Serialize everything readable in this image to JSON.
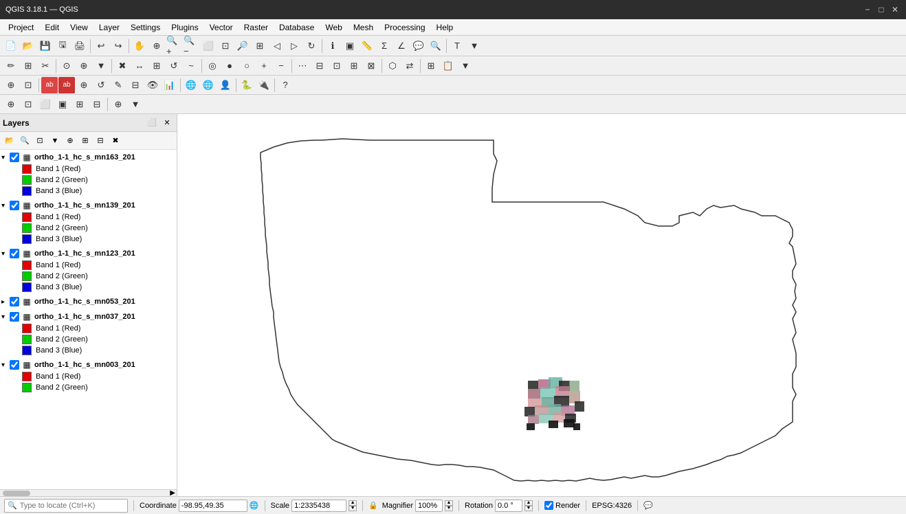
{
  "titlebar": {
    "title": "QGIS 3.18.1 — QGIS",
    "min_btn": "−",
    "max_btn": "□",
    "close_btn": "✕"
  },
  "menubar": {
    "items": [
      {
        "id": "project",
        "label": "Project"
      },
      {
        "id": "edit",
        "label": "Edit"
      },
      {
        "id": "view",
        "label": "View"
      },
      {
        "id": "layer",
        "label": "Layer"
      },
      {
        "id": "settings",
        "label": "Settings"
      },
      {
        "id": "plugins",
        "label": "Plugins"
      },
      {
        "id": "vector",
        "label": "Vector"
      },
      {
        "id": "raster",
        "label": "Raster"
      },
      {
        "id": "database",
        "label": "Database"
      },
      {
        "id": "web",
        "label": "Web"
      },
      {
        "id": "mesh",
        "label": "Mesh"
      },
      {
        "id": "processing",
        "label": "Processing"
      },
      {
        "id": "help",
        "label": "Help"
      }
    ]
  },
  "layers_panel": {
    "title": "Layers",
    "layers": [
      {
        "id": "layer1",
        "name": "ortho_1-1_hc_s_mn163_201",
        "checked": true,
        "expanded": true,
        "bands": [
          {
            "color": "#e00000",
            "label": "Band 1 (Red)"
          },
          {
            "color": "#00cc00",
            "label": "Band 2 (Green)"
          },
          {
            "color": "#0000dd",
            "label": "Band 3 (Blue)"
          }
        ]
      },
      {
        "id": "layer2",
        "name": "ortho_1-1_hc_s_mn139_201",
        "checked": true,
        "expanded": true,
        "bands": [
          {
            "color": "#e00000",
            "label": "Band 1 (Red)"
          },
          {
            "color": "#00cc00",
            "label": "Band 2 (Green)"
          },
          {
            "color": "#0000dd",
            "label": "Band 3 (Blue)"
          }
        ]
      },
      {
        "id": "layer3",
        "name": "ortho_1-1_hc_s_mn123_201",
        "checked": true,
        "expanded": true,
        "bands": [
          {
            "color": "#e00000",
            "label": "Band 1 (Red)"
          },
          {
            "color": "#00cc00",
            "label": "Band 2 (Green)"
          },
          {
            "color": "#0000dd",
            "label": "Band 3 (Blue)"
          }
        ]
      },
      {
        "id": "layer4",
        "name": "ortho_1-1_hc_s_mn053_201",
        "checked": true,
        "expanded": false,
        "bands": []
      },
      {
        "id": "layer5",
        "name": "ortho_1-1_hc_s_mn037_201",
        "checked": true,
        "expanded": true,
        "bands": [
          {
            "color": "#e00000",
            "label": "Band 1 (Red)"
          },
          {
            "color": "#00cc00",
            "label": "Band 2 (Green)"
          },
          {
            "color": "#0000dd",
            "label": "Band 3 (Blue)"
          }
        ]
      },
      {
        "id": "layer6",
        "name": "ortho_1-1_hc_s_mn003_201",
        "checked": true,
        "expanded": true,
        "bands": [
          {
            "color": "#e00000",
            "label": "Band 1 (Red)"
          },
          {
            "color": "#00cc00",
            "label": "Band 2 (Green)"
          }
        ]
      }
    ]
  },
  "statusbar": {
    "locate_placeholder": "Type to locate (Ctrl+K)",
    "coordinate_label": "Coordinate",
    "coordinate_value": "-98.95,49.35",
    "scale_label": "Scale",
    "scale_value": "1:2335438",
    "magnifier_label": "Magnifier",
    "magnifier_value": "100%",
    "rotation_label": "Rotation",
    "rotation_value": "0.0 °",
    "render_label": "Render",
    "epsg_label": "EPSG:4326"
  },
  "icons": {
    "layers_panel_icon": "⬜",
    "search_icon": "🔍",
    "gear_icon": "⚙",
    "raster_icon": "▦",
    "expand_arrow": "▾",
    "collapse_arrow": "▸",
    "lock_icon": "🔒",
    "globe_icon": "🌐"
  }
}
